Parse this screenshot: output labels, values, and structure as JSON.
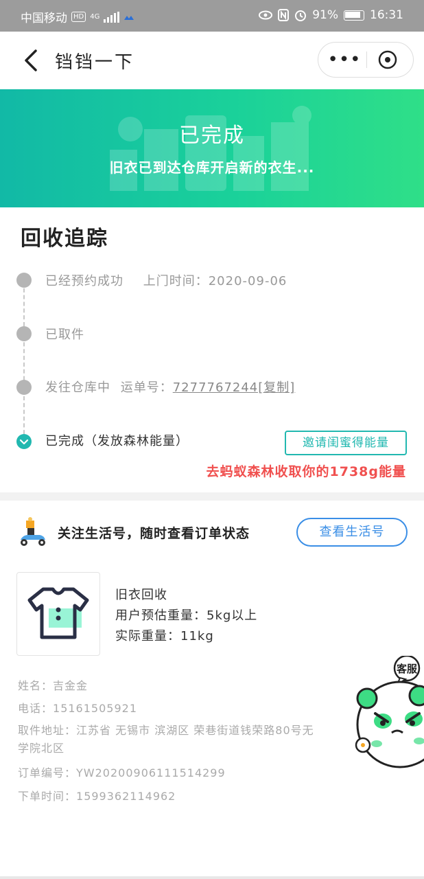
{
  "status_bar": {
    "carrier": "中国移动",
    "hd_badge": "HD",
    "network": "4G",
    "battery": "91%",
    "time": "16:31"
  },
  "nav": {
    "title": "铛铛一下",
    "more_label": "•••"
  },
  "banner": {
    "title": "已完成",
    "subtitle": "旧衣已到达仓库开启新的衣生..."
  },
  "tracking": {
    "section_title": "回收追踪",
    "steps": [
      {
        "label": "已经预约成功",
        "extra_label": "上门时间：",
        "extra_value": "2020-09-06"
      },
      {
        "label": "已取件"
      },
      {
        "label": "发往仓库中",
        "extra_label": "运单号：",
        "extra_value": "7277767244[复制]"
      },
      {
        "label": "已完成（发放森林能量）"
      }
    ],
    "invite_button": "邀请闺蜜得能量",
    "energy_text": "去蚂蚁森林收取你的1738g能量"
  },
  "follow": {
    "text": "关注生活号，随时查看订单状态",
    "button": "查看生活号"
  },
  "product": {
    "name": "旧衣回收",
    "estimated_weight": "用户预估重量：5kg以上",
    "actual_weight": "实际重量：11kg"
  },
  "order_info": {
    "name_label": "姓名：",
    "name_value": "吉金金",
    "phone_label": "电话：",
    "phone_value": "15161505921",
    "address_label": "取件地址：",
    "address_line1": "江苏省 无锡市 滨湖区 荣巷街道钱荣路80号无",
    "address_line2": "学院北区",
    "order_no_label": "订单编号：",
    "order_no_value": "YW20200906111514299",
    "order_time_label": "下单时间：",
    "order_time_value": "1599362114962"
  },
  "customer_service": {
    "label": "客服"
  },
  "colors": {
    "accent_teal": "#21b8b0",
    "banner_green": "#2fdf88",
    "energy_red": "#f0504f",
    "link_blue": "#3a8ee6"
  }
}
